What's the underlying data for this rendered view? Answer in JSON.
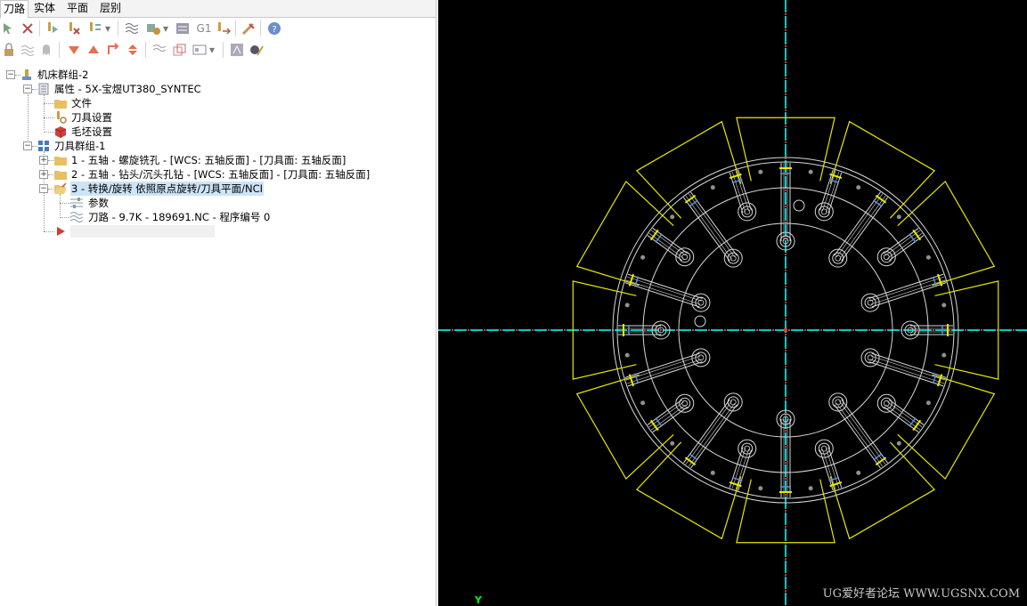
{
  "tabs": [
    "刀路",
    "实体",
    "平面",
    "层别"
  ],
  "toolbar_row1": [
    "select-toolpath-icon",
    "deselect-icon",
    "regen-icon",
    "regen-dirty-icon",
    "sort-icon",
    "backplot-icon",
    "verify-icon",
    "post-icon",
    "g1-icon",
    "export-icon",
    "highspeed-icon",
    "help-icon"
  ],
  "toolbar_row2": [
    "lock-icon",
    "toggle-display-icon",
    "ghost-icon",
    "move-down-icon",
    "move-up-icon",
    "insert-arrow-icon",
    "expand-collapse-icon",
    "wave-icon",
    "batch-icon",
    "view-options-icon",
    "simulate-icon",
    "tool-manager-icon"
  ],
  "g1_label": "G1",
  "tree": {
    "machine_group": "机床群组-2",
    "properties": "属性 - 5X-宝煜UT380_SYNTEC",
    "files": "文件",
    "tool_settings": "刀具设置",
    "stock_settings": "毛坯设置",
    "toolpath_group": "刀具群组-1",
    "op1": "1 - 五轴 - 螺旋铣孔 - [WCS: 五轴反面] - [刀具面: 五轴反面]",
    "op2": "2 - 五轴 - 钻头/沉头孔钻 - [WCS: 五轴反面] - [刀具面: 五轴反面]",
    "op3": "3 - 转换/旋转 依照原点旋转/刀具平面/NCI",
    "params": "参数",
    "toolpath": "刀路 - 9.7K - 189691.NC - 程序编号 0"
  },
  "viewport": {
    "axis_label": "Y",
    "watermark": "UG爱好者论坛 WWW.UGSNX.COM",
    "background": "#000000",
    "geometry_color": "#d8d8d8",
    "stock_color": "#e8e800",
    "axis_color": "#00c8c8",
    "axis_dash_color": "#ff3030"
  }
}
